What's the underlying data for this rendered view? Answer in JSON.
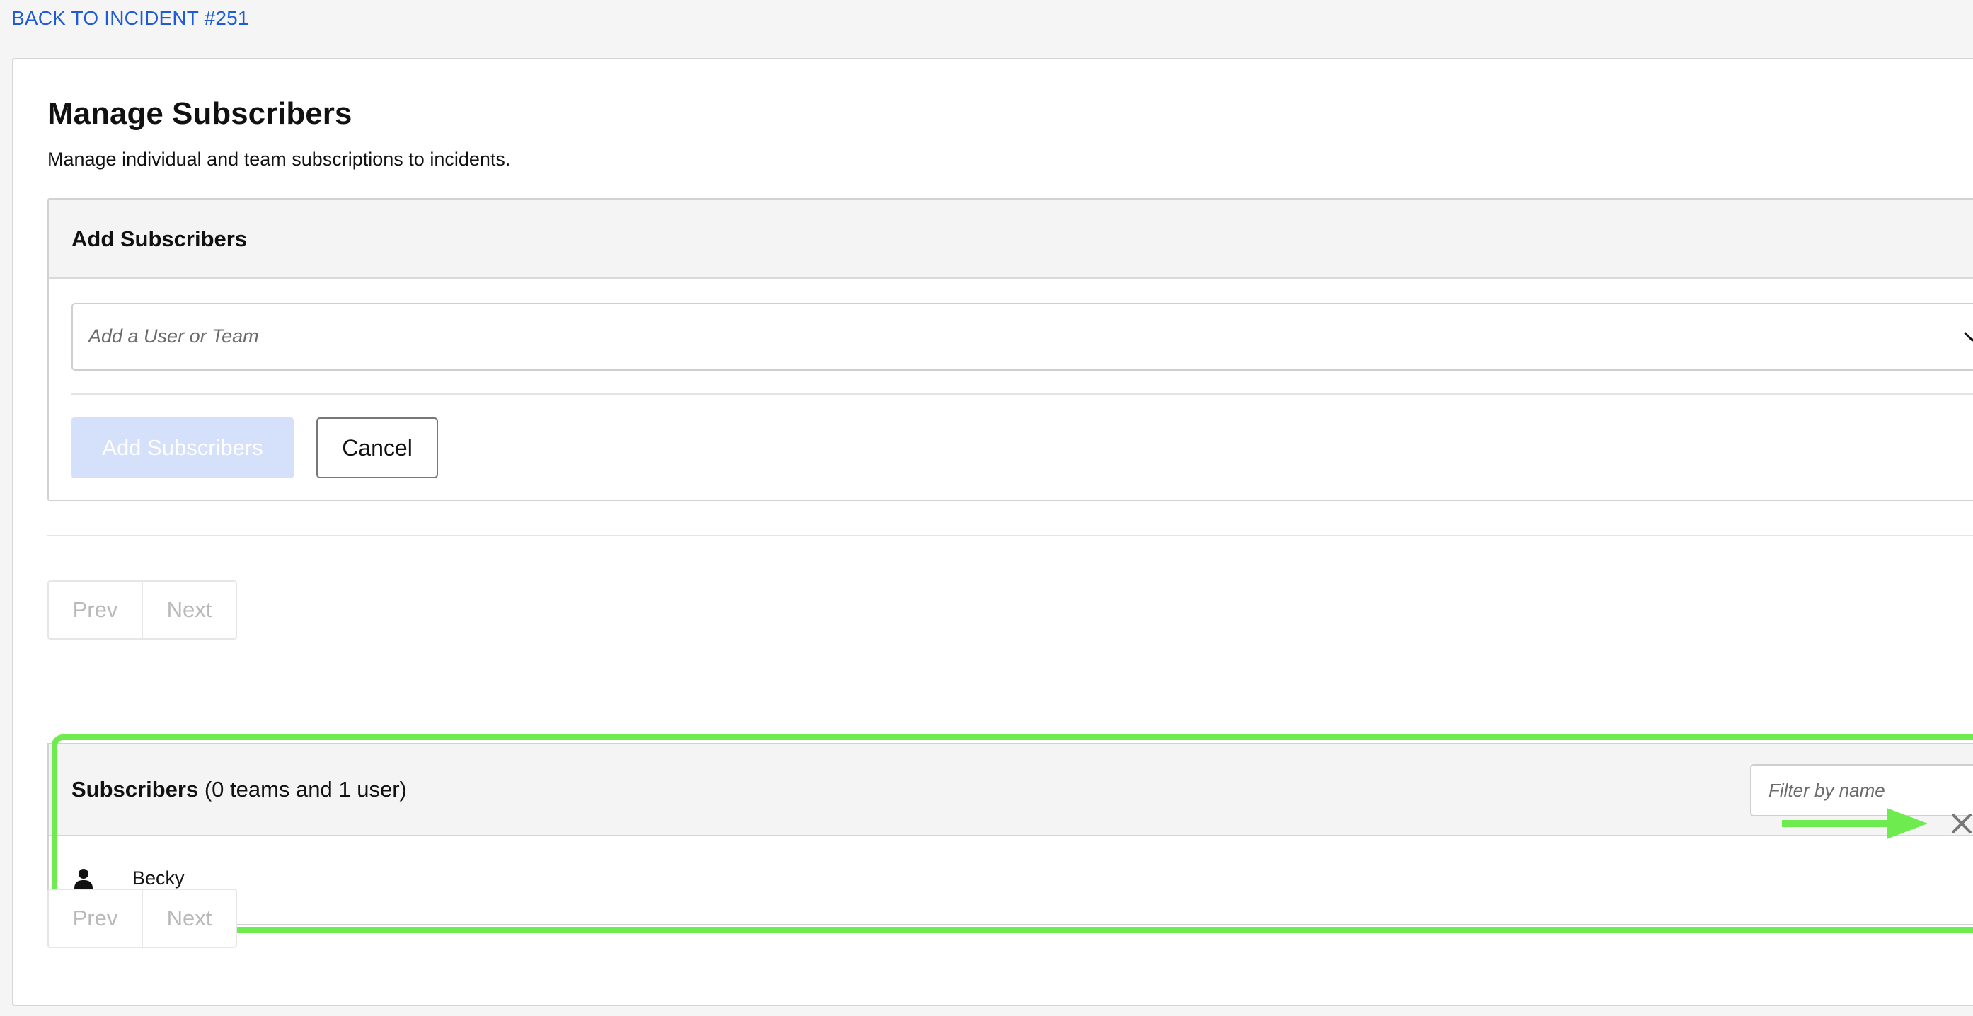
{
  "nav": {
    "back_link": "BACK TO INCIDENT #251"
  },
  "page": {
    "title": "Manage Subscribers",
    "subtitle": "Manage individual and team subscriptions to incidents."
  },
  "add_panel": {
    "title": "Add Subscribers",
    "select_placeholder": "Add a User or Team",
    "add_button_label": "Add Subscribers",
    "cancel_button_label": "Cancel"
  },
  "pagination": {
    "prev_label": "Prev",
    "next_label": "Next"
  },
  "subscribers": {
    "title_strong": "Subscribers",
    "title_count": " (0 teams and 1 user)",
    "filter_placeholder": "Filter by name",
    "items": [
      {
        "name": "Becky",
        "icon": "user-icon"
      }
    ]
  },
  "annotation": {
    "highlight_color": "#6eec4f",
    "arrow_icon": "arrow-right-icon"
  },
  "colors": {
    "link": "#1f5bd6",
    "disabled_primary_bg": "#d5e0fb",
    "background": "#f5f5f5"
  }
}
